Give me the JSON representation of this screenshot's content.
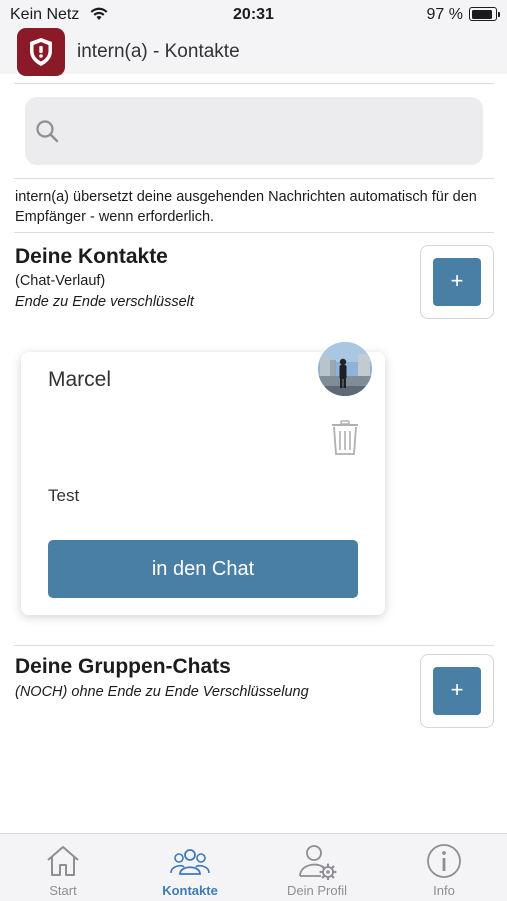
{
  "status_bar": {
    "carrier": "Kein Netz",
    "time": "20:31",
    "battery": "97 %"
  },
  "app_bar": {
    "title": "intern(a) - Kontakte"
  },
  "search": {
    "placeholder": "",
    "value": ""
  },
  "info_text": "intern(a) übersetzt deine ausgehenden Nachrichten automatisch für den Empfänger - wenn erforderlich.",
  "contacts_section": {
    "title": "Deine Kontakte",
    "subtitle": "(Chat-Verlauf)",
    "encryption": "Ende zu Ende verschlüsselt",
    "add_label": "+"
  },
  "contact_card": {
    "name": "Marcel",
    "last_message": "Test",
    "chat_button": "in den Chat"
  },
  "groups_section": {
    "title": "Deine Gruppen-Chats",
    "encryption": "(NOCH) ohne Ende zu Ende Verschlüsselung",
    "add_label": "+"
  },
  "tab_bar": {
    "tabs": [
      {
        "label": "Start",
        "icon": "home-icon",
        "active": false
      },
      {
        "label": "Kontakte",
        "icon": "contacts-icon",
        "active": true
      },
      {
        "label": "Dein Profil",
        "icon": "profile-settings-icon",
        "active": false
      },
      {
        "label": "Info",
        "icon": "info-icon",
        "active": false
      }
    ]
  },
  "colors": {
    "accent": "#4a7fa5",
    "active_tab": "#3d7bb5",
    "logo": "#8b1a28"
  }
}
